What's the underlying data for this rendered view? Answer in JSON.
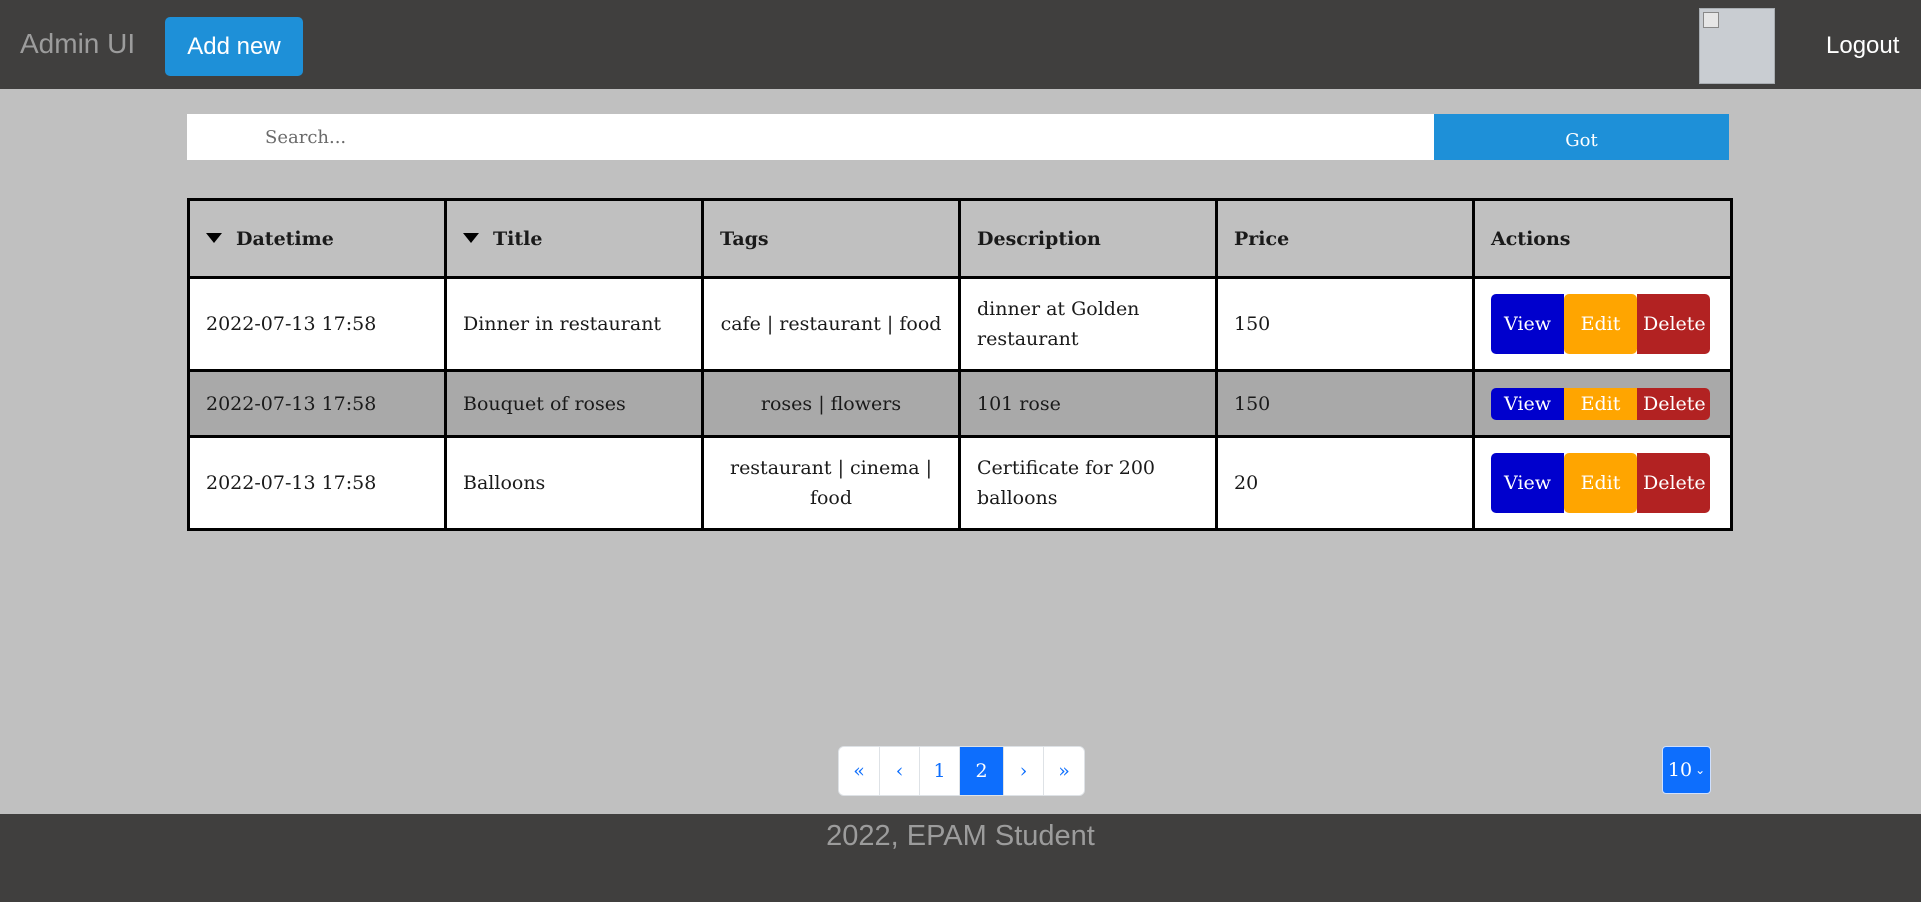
{
  "header": {
    "brand": "Admin UI",
    "add_new_label": "Add new",
    "logout_label": "Logout",
    "avatar_icon": "broken-image-icon"
  },
  "search": {
    "placeholder": "Search...",
    "value": "",
    "button_label": "Got"
  },
  "table": {
    "columns": [
      {
        "label": "Datetime",
        "sortable": true
      },
      {
        "label": "Title",
        "sortable": true
      },
      {
        "label": "Tags",
        "sortable": false
      },
      {
        "label": "Description",
        "sortable": false
      },
      {
        "label": "Price",
        "sortable": false
      },
      {
        "label": "Actions",
        "sortable": false
      }
    ],
    "rows": [
      {
        "datetime": "2022-07-13 17:58",
        "title": "Dinner in restaurant",
        "tags": "cafe  |  restaurant  |  food",
        "description": "dinner at Golden restaurant",
        "price": "150"
      },
      {
        "datetime": "2022-07-13 17:58",
        "title": "Bouquet of roses",
        "tags": "roses  |  flowers",
        "description": "101 rose",
        "price": "150"
      },
      {
        "datetime": "2022-07-13 17:58",
        "title": "Balloons",
        "tags": "restaurant  |  cinema  |  food",
        "description": "Certificate for 200 balloons",
        "price": "20"
      }
    ],
    "actions": {
      "view": "View",
      "edit": "Edit",
      "delete": "Delete"
    },
    "highlighted_row": 1
  },
  "pagination": {
    "first": "«",
    "prev": "‹",
    "pages": [
      "1",
      "2"
    ],
    "current_page": "2",
    "next": "›",
    "last": "»",
    "page_size": "10"
  },
  "footer": {
    "text": "2022, EPAM Student"
  },
  "colors": {
    "header_bg": "#403f3e",
    "page_bg": "#c0c0c0",
    "primary": "#1e90d8",
    "view": "#0000cd",
    "edit": "#ffa500",
    "delete": "#b22222",
    "pager_active": "#0d6efd"
  }
}
